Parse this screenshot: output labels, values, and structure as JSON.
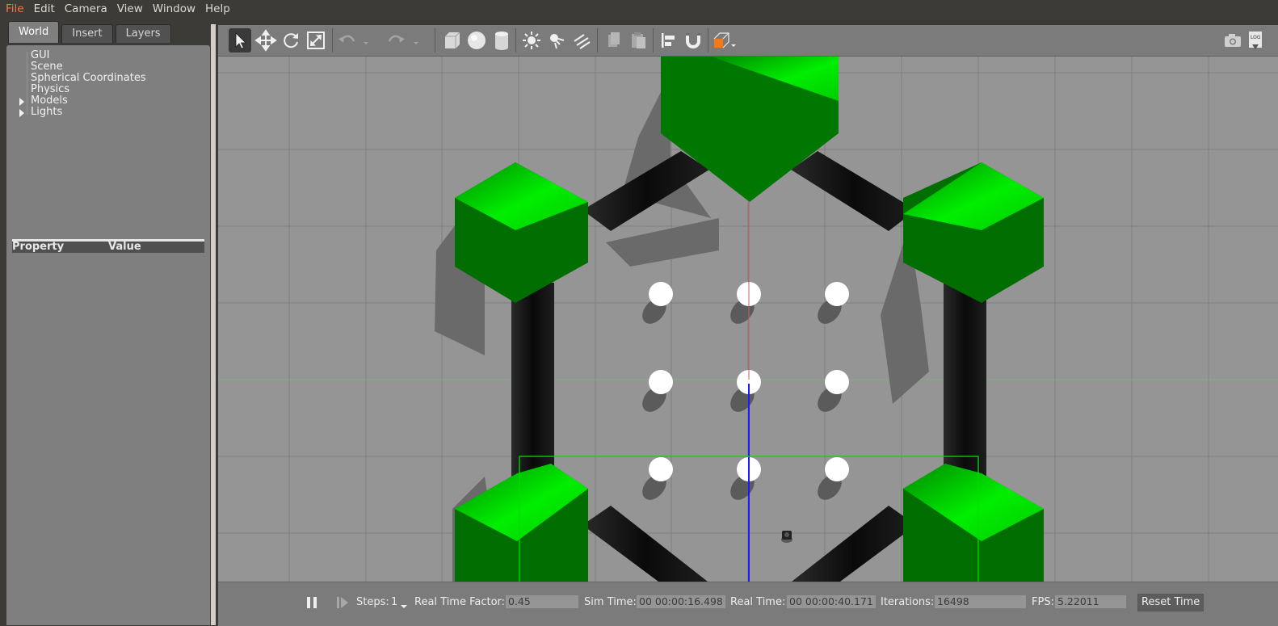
{
  "menu": [
    "File",
    "Edit",
    "Camera",
    "View",
    "Window",
    "Help"
  ],
  "left_panel": {
    "tabs": [
      "World",
      "Insert",
      "Layers"
    ],
    "active_tab": "World",
    "tree_items": [
      "GUI",
      "Scene",
      "Spherical Coordinates",
      "Physics",
      "Models",
      "Lights"
    ],
    "property_header": "Property",
    "value_header": "Value"
  },
  "toolbar": {
    "icons": [
      "select-arrow-icon",
      "translate-icon",
      "rotate-icon",
      "scale-icon",
      "undo-icon",
      "redo-icon",
      "box-icon",
      "sphere-icon",
      "cylinder-icon",
      "point-light-icon",
      "spot-light-icon",
      "directional-light-icon",
      "copy-icon",
      "paste-icon",
      "align-icon",
      "snap-icon",
      "view-angle-icon",
      "screenshot-icon",
      "log-icon"
    ],
    "log_label": "LOG",
    "active_tool": "select-arrow-icon"
  },
  "bottom_bar": {
    "steps_label": "Steps:",
    "steps_value": "1",
    "rtf_label": "Real Time Factor:",
    "rtf_value": "0.45",
    "sim_time_label": "Sim Time:",
    "sim_time_value": "00 00:00:16.498",
    "real_time_label": "Real Time:",
    "real_time_value": "00 00:00:40.171",
    "iterations_label": "Iterations:",
    "iterations_value": "16498",
    "fps_label": "FPS:",
    "fps_value": "5.22011",
    "reset_label": "Reset Time"
  },
  "colors": {
    "menu_active": "#f07746",
    "green_object": "#00b400",
    "wall": "#111111",
    "ground": "#959595"
  }
}
